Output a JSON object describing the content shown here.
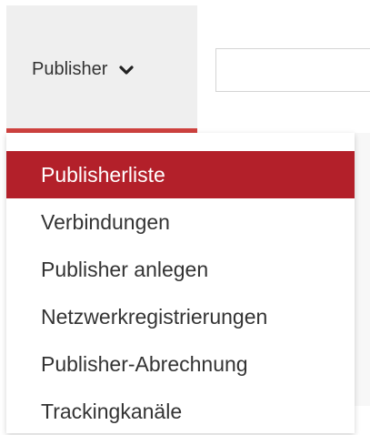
{
  "nav": {
    "publisher_label": "Publisher",
    "chevron_icon": "chevron-down-icon"
  },
  "search": {
    "value": "",
    "placeholder": ""
  },
  "dropdown": {
    "items": [
      {
        "label": "Publisherliste",
        "active": true
      },
      {
        "label": "Verbindungen",
        "active": false
      },
      {
        "label": "Publisher anlegen",
        "active": false
      },
      {
        "label": "Netzwerkregistrierungen",
        "active": false
      },
      {
        "label": "Publisher-Abrechnung",
        "active": false
      },
      {
        "label": "Trackingkanäle",
        "active": false
      }
    ]
  },
  "colors": {
    "accent": "#b3202a",
    "tab_underline": "#d0423f",
    "tab_background": "#efefef"
  }
}
